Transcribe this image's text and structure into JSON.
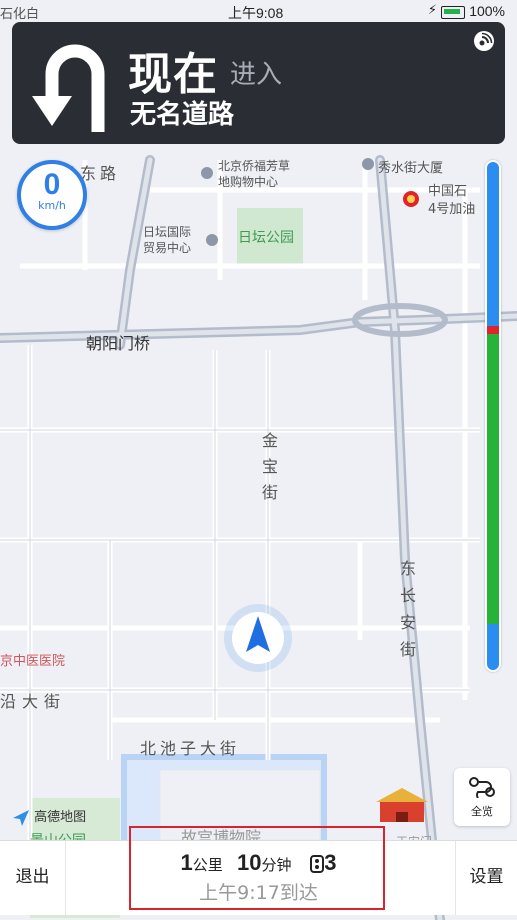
{
  "status_bar": {
    "time": "上午9:08",
    "battery_percent": "100%",
    "top_left_road": "石化白",
    "battery_color": "#21b24a"
  },
  "navigation": {
    "maneuver_icon": "u-turn-icon",
    "instruction_now": "现在",
    "instruction_action": "进入",
    "road_name": "无名道路"
  },
  "speed": {
    "value": "0",
    "unit": "km/h"
  },
  "map": {
    "labels": {
      "zhaoyang_bridge": "朝阳门桥",
      "jinbao_street": [
        "金",
        "宝",
        "街"
      ],
      "dongchangan": [
        "东",
        "长",
        "安",
        "街"
      ],
      "beichizi": "北池子大街",
      "ritan_park": "日坛公园",
      "ritan_trade": [
        "日坛国际",
        "贸易中心"
      ],
      "qiaofu_museum": [
        "北京侨福芳草",
        "地购物中心"
      ],
      "xiushui": "秀水街大厦",
      "sinopec": [
        "中国石",
        "4号加油"
      ],
      "palace_museum": "故宫博物院",
      "hospital": "京中医医院",
      "yanjie": "沿大街",
      "market_road": "场东路",
      "jingshan": "景山公园",
      "tiananmen": "天安门"
    },
    "brand_logo_text": "高德地图"
  },
  "traffic_bar": {
    "colors": {
      "free": "#2b8df0",
      "jam": "#e0242a",
      "smooth": "#27b23a"
    }
  },
  "overview_button": {
    "label": "全览",
    "icon": "route-overview-icon"
  },
  "bottom_bar": {
    "exit_label": "退出",
    "settings_label": "设置",
    "distance_value": "1",
    "distance_unit": "公里",
    "time_value": "10",
    "time_unit": "分钟",
    "traffic_lights_count": "3",
    "arrival_text": "上午9:17到达"
  }
}
